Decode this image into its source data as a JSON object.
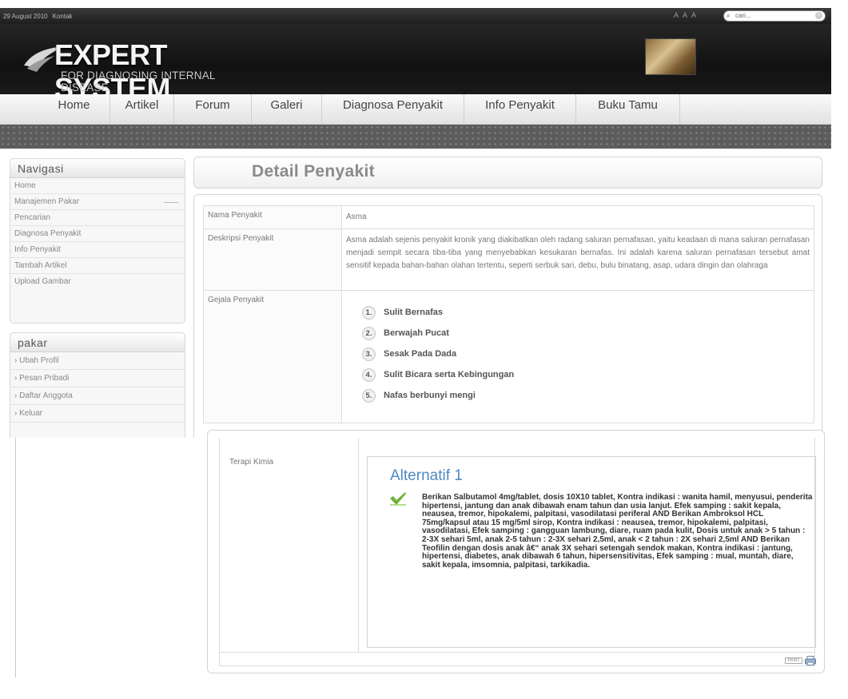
{
  "topbar": {
    "date": "29 August 2010",
    "contact": "Kontak",
    "font_sizes": [
      "A",
      "A",
      "A"
    ],
    "search_placeholder": "cari..."
  },
  "logo": {
    "title": "EXPERT SYSTEM",
    "subtitle": "FOR DIAGNOSING INTERNAL DISEASE"
  },
  "nav": {
    "items": [
      "Home",
      "Artikel",
      "Forum",
      "Galeri",
      "Diagnosa Penyakit",
      "Info Penyakit",
      "Buku Tamu"
    ]
  },
  "sidebar": {
    "navigasi_title": "Navigasi",
    "navigasi_items": [
      "Home",
      "Manajemen Pakar",
      "Pencarian",
      "Diagnosa Penyakit",
      "Info Penyakit",
      "Tambah Artikel",
      "Upload Gambar"
    ],
    "pakar_title": "pakar",
    "pakar_items": [
      "› Ubah Profil",
      "› Pesan Pribadi",
      "› Daftar Anggota",
      "› Keluar"
    ]
  },
  "page": {
    "title": "Detail Penyakit"
  },
  "detail": {
    "name_label": "Nama Penyakit",
    "name_value": "Asma",
    "desc_label": "Deskripsi Penyakit",
    "desc_value": "Asma adalah sejenis penyakit kronik yang diakibatkan oleh radang saluran pernafasan, yaitu keadaan di mana saluran pernafasan menjadi sempit secara tiba-tiba yang menyebabkan kesukaran bernafas. Ini adalah karena saluran pernafasan tersebut amat sensitif kepada bahan-bahan olahan tertentu, seperti serbuk sari, debu, bulu binatang, asap, udara dingin dan olahraga",
    "symptoms_label": "Gejala Penyakit",
    "symptoms": [
      {
        "num": "1.",
        "text": "Sulit Bernafas"
      },
      {
        "num": "2.",
        "text": "Berwajah Pucat"
      },
      {
        "num": "3.",
        "text": "Sesak Pada Dada"
      },
      {
        "num": "4.",
        "text": "Sulit Bicara serta Kebingungan"
      },
      {
        "num": "5.",
        "text": "Nafas berbunyi mengi"
      }
    ],
    "therapy_label": "Terapi Kimia",
    "alt_title": "Alternatif 1",
    "alt_text": "Berikan Salbutamol 4mg/tablet, dosis 10X10 tablet, Kontra indikasi : wanita hamil, menyusui, penderita hipertensi, jantung dan anak dibawah enam tahun dan usia lanjut. Efek samping : sakit kepala, neausea, tremor, hipokalemi, palpitasi, vasodilatasi periferal AND Berikan Ambroksol HCL 75mg/kapsul atau 15 mg/5ml sirop, Kontra indikasi : neausea, tremor, hipokalemi, palpitasi, vasodilatasi, Efek samping : gangguan lambung, diare, ruam pada kulit, Dosis untuk anak > 5 tahun : 2-3X sehari 5ml, anak 2-5 tahun : 2-3X sehari 2,5ml, anak < 2 tahun : 2X sehari 2,5ml AND Berikan Teofilin dengan dosis anak â€“ anak 3X sehari setengah sendok makan, Kontra indikasi : jantung, hipertensi, diabetes, anak dibawah 6 tahun, hipersensitivitas, Efek samping : mual, muntah, diare, sakit kepala, imsomnia, palpitasi, tarkikadia.",
    "print_label": "PRINT"
  },
  "colors": {
    "header_bg": "#1a1a1a",
    "strip_bg": "#5c5c5c",
    "alt_title": "#4f8ac1",
    "check_icon": "#6fb23a"
  }
}
